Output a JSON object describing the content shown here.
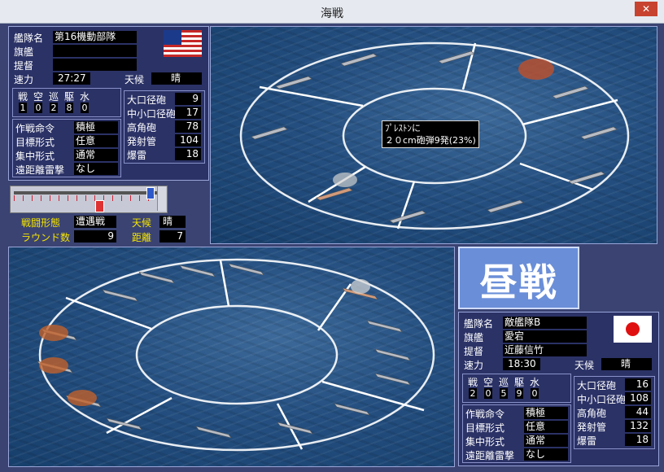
{
  "window": {
    "title": "海戦",
    "close": "✕"
  },
  "allied": {
    "labels": {
      "fleet": "艦隊名",
      "flagship": "旗艦",
      "admiral": "提督",
      "speed": "速力",
      "weather": "天候"
    },
    "fleet_name": "第16機動部隊",
    "flagship": "",
    "admiral": "",
    "speed": "27:27",
    "weather": "晴",
    "flag": "usa",
    "ship_types": {
      "headers": [
        "戦",
        "空",
        "巡",
        "駆",
        "水"
      ],
      "counts": [
        "1",
        "0",
        "2",
        "8",
        "0"
      ]
    },
    "weapons": [
      {
        "label": "大口径砲",
        "value": "9"
      },
      {
        "label": "中小口径砲",
        "value": "17"
      },
      {
        "label": "高角砲",
        "value": "78"
      },
      {
        "label": "発射管",
        "value": "104"
      },
      {
        "label": "爆雷",
        "value": "18"
      }
    ],
    "orders": [
      {
        "label": "作戦命令",
        "value": "積極"
      },
      {
        "label": "目標形式",
        "value": "任意"
      },
      {
        "label": "集中形式",
        "value": "通常"
      },
      {
        "label": "遠距離雷撃",
        "value": "なし"
      }
    ]
  },
  "battle": {
    "formation_label": "戦闘形態",
    "formation": "遭遇戦",
    "weather_label": "天候",
    "weather": "晴",
    "round_label": "ラウンド数",
    "round": "9",
    "distance_label": "距離",
    "distance": "7",
    "slider_level": 0.97
  },
  "tooltip": {
    "line1": "ﾌﾟﾚｽﾄﾝに",
    "line2": "２０cm砲弾9発(23%)"
  },
  "phase": {
    "label": "昼戦"
  },
  "enemy": {
    "labels": {
      "fleet": "艦隊名",
      "flagship": "旗艦",
      "admiral": "提督",
      "speed": "速力",
      "weather": "天候"
    },
    "fleet_name": "敵艦隊B",
    "flagship": "愛宕",
    "admiral": "近藤信竹",
    "speed": "18:30",
    "weather": "晴",
    "flag": "japan",
    "ship_types": {
      "headers": [
        "戦",
        "空",
        "巡",
        "駆",
        "水"
      ],
      "counts": [
        "2",
        "0",
        "5",
        "9",
        "0"
      ]
    },
    "weapons": [
      {
        "label": "大口径砲",
        "value": "16"
      },
      {
        "label": "中小口径砲",
        "value": "108"
      },
      {
        "label": "高角砲",
        "value": "44"
      },
      {
        "label": "発射管",
        "value": "132"
      },
      {
        "label": "爆雷",
        "value": "18"
      }
    ],
    "orders": [
      {
        "label": "作戦命令",
        "value": "積極"
      },
      {
        "label": "目標形式",
        "value": "任意"
      },
      {
        "label": "集中形式",
        "value": "通常"
      },
      {
        "label": "遠距離雷撃",
        "value": "なし"
      }
    ]
  },
  "colors": {
    "panel": "#2b3266",
    "label_yellow": "#f5e400",
    "phase_bg": "#6a8ed8"
  }
}
